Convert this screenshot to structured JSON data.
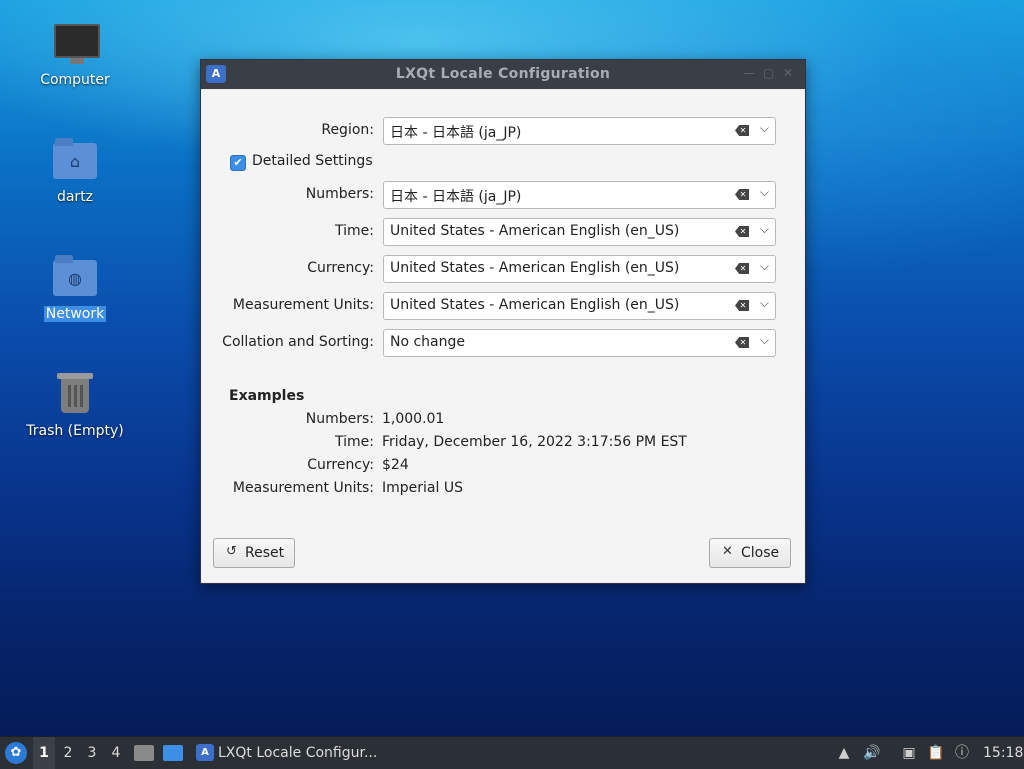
{
  "desktop": {
    "icons": [
      {
        "label": "Computer"
      },
      {
        "label": "dartz"
      },
      {
        "label": "Network"
      },
      {
        "label": "Trash (Empty)"
      }
    ]
  },
  "window": {
    "title": "LXQt Locale Configuration",
    "region": {
      "label": "Region:",
      "value": "日本 - 日本語 (ja_JP)"
    },
    "detailed_settings": {
      "label": "Detailed Settings",
      "checked": true
    },
    "fields": [
      {
        "label": "Numbers:",
        "value": "日本 - 日本語 (ja_JP)"
      },
      {
        "label": "Time:",
        "value": "United States - American English (en_US)"
      },
      {
        "label": "Currency:",
        "value": "United States - American English (en_US)"
      },
      {
        "label": "Measurement Units:",
        "value": "United States - American English (en_US)"
      },
      {
        "label": "Collation and Sorting:",
        "value": "No change"
      }
    ],
    "examples": {
      "heading": "Examples",
      "rows": [
        {
          "label": "Numbers:",
          "value": "1,000.01"
        },
        {
          "label": "Time:",
          "value": "Friday, December 16, 2022 3:17:56 PM EST"
        },
        {
          "label": "Currency:",
          "value": "$24"
        },
        {
          "label": "Measurement Units:",
          "value": "Imperial US"
        }
      ]
    },
    "buttons": {
      "reset": "Reset",
      "close": "Close"
    }
  },
  "taskbar": {
    "workspaces": [
      "1",
      "2",
      "3",
      "4"
    ],
    "active_workspace": "1",
    "task_title": "LXQt Locale Configur...",
    "clock": "15:18"
  },
  "colors": {
    "accent": "#3d8ee6",
    "titlebar": "#3a3f47",
    "taskbar": "#2b2f36"
  }
}
